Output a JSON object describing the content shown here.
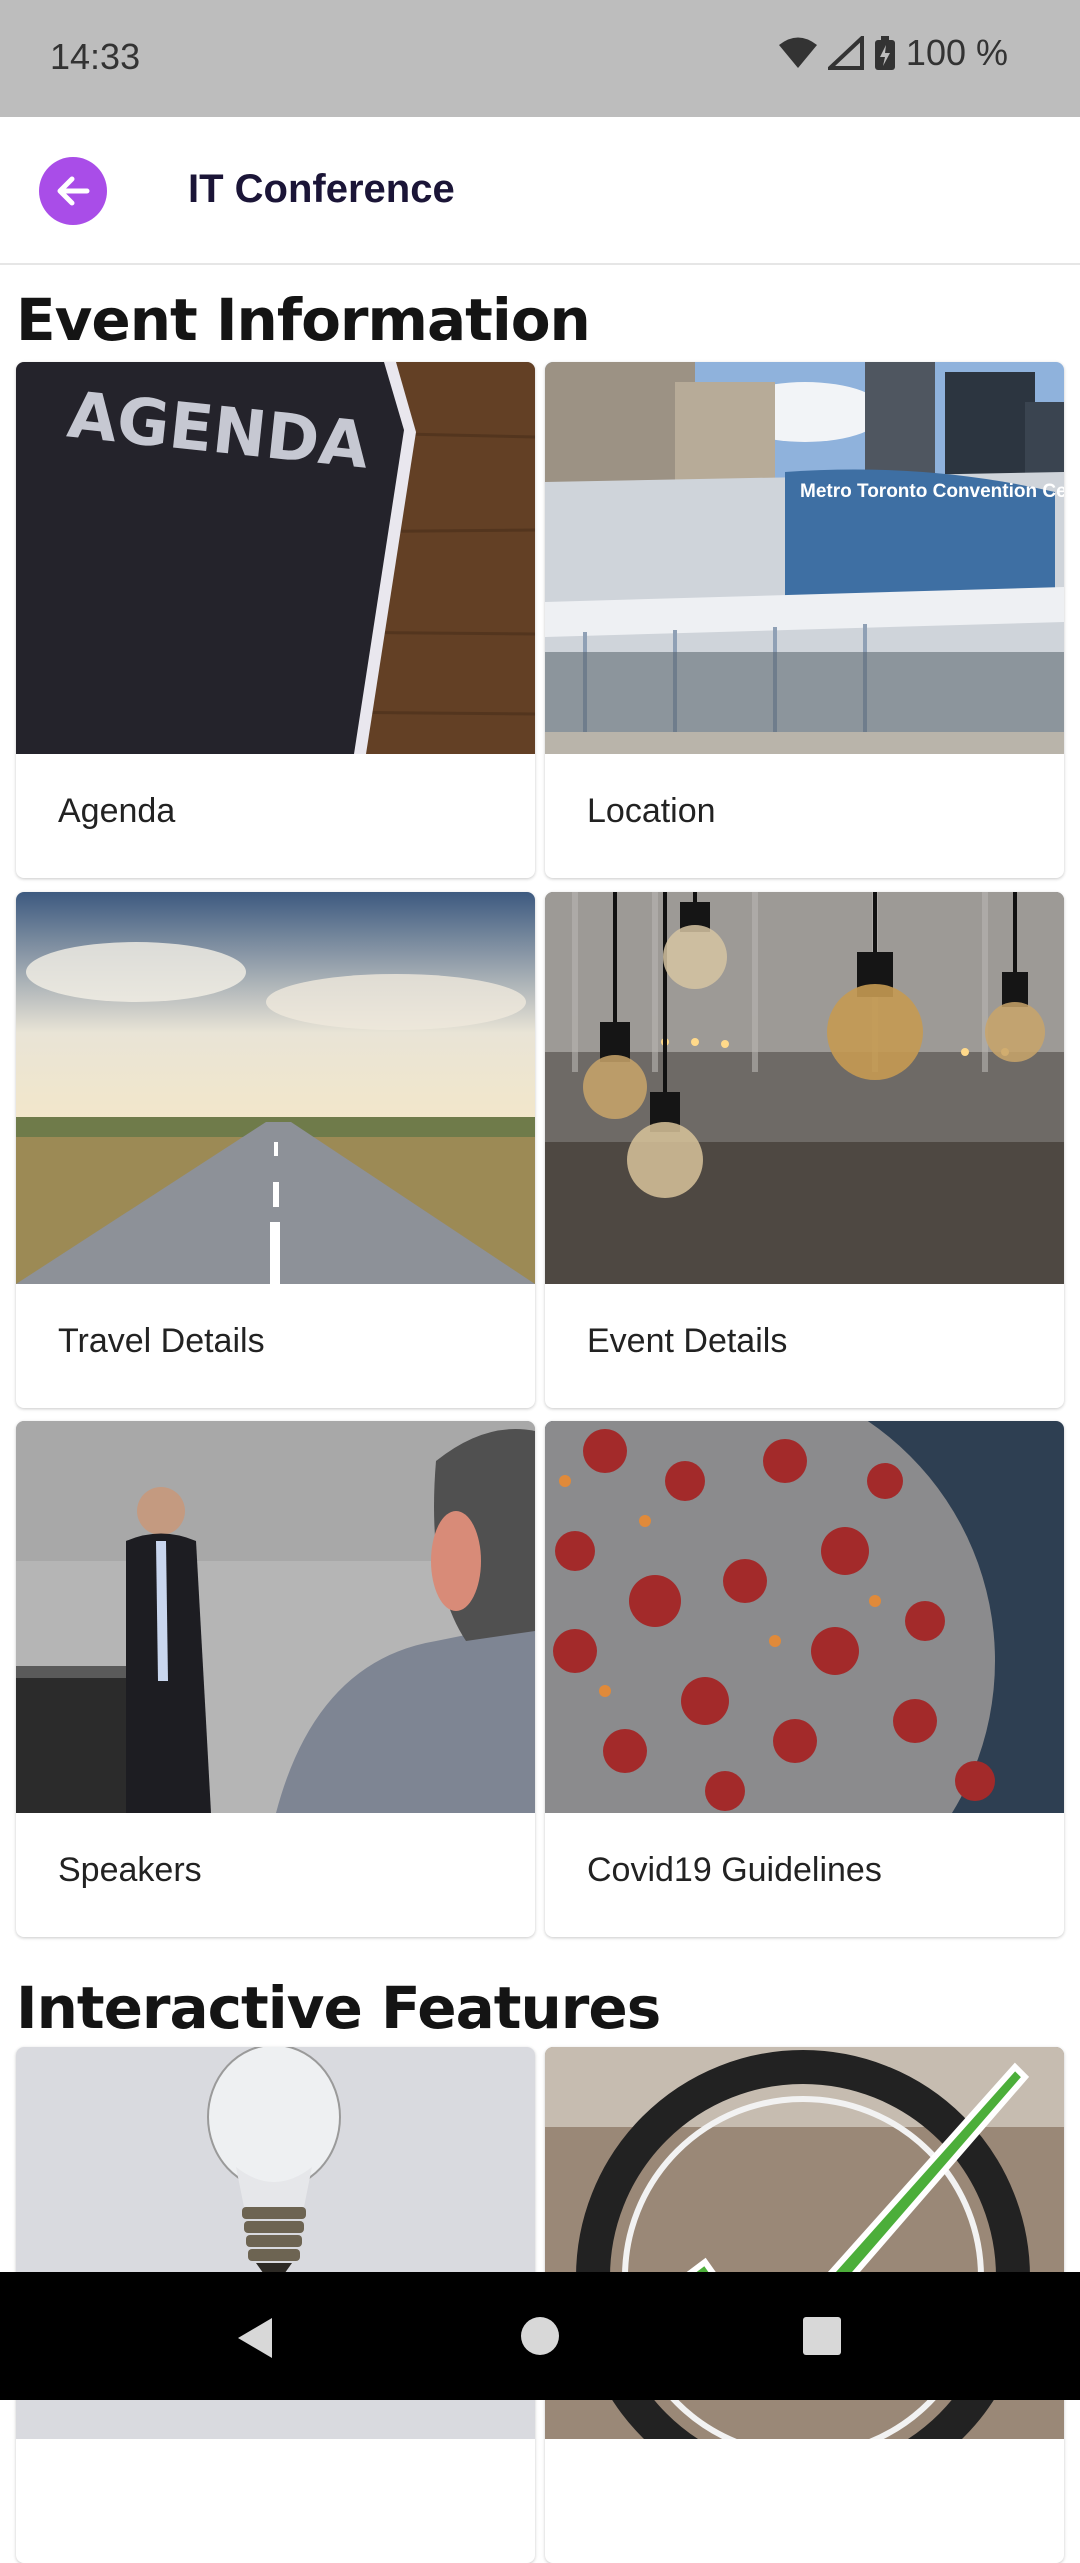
{
  "status_bar": {
    "time": "14:33",
    "battery_percent": "100 %",
    "icons": [
      "wifi-icon",
      "signal-icon",
      "battery-icon"
    ]
  },
  "app_bar": {
    "title": "IT Conference",
    "back_icon": "arrow-left-icon",
    "accent_color": "#a94de8"
  },
  "sections": [
    {
      "title": "Event Information",
      "cards": [
        {
          "label": "Agenda",
          "image": "agenda-book-image"
        },
        {
          "label": "Location",
          "image": "convention-centre-image"
        },
        {
          "label": "Travel Details",
          "image": "road-image"
        },
        {
          "label": "Event Details",
          "image": "light-bulbs-image"
        },
        {
          "label": "Speakers",
          "image": "speaker-image"
        },
        {
          "label": "Covid19 Guidelines",
          "image": "virus-image"
        }
      ]
    },
    {
      "title": "Interactive Features",
      "cards": [
        {
          "label": "",
          "image": "light-bulb-image"
        },
        {
          "label": "",
          "image": "checkmark-image"
        }
      ]
    }
  ],
  "image_text": {
    "agenda_book": "AGENDA",
    "building_sign": "Metro Toronto Convention Ce"
  },
  "nav_bar": {
    "icons": [
      "back-triangle-icon",
      "home-circle-icon",
      "recents-square-icon"
    ]
  }
}
